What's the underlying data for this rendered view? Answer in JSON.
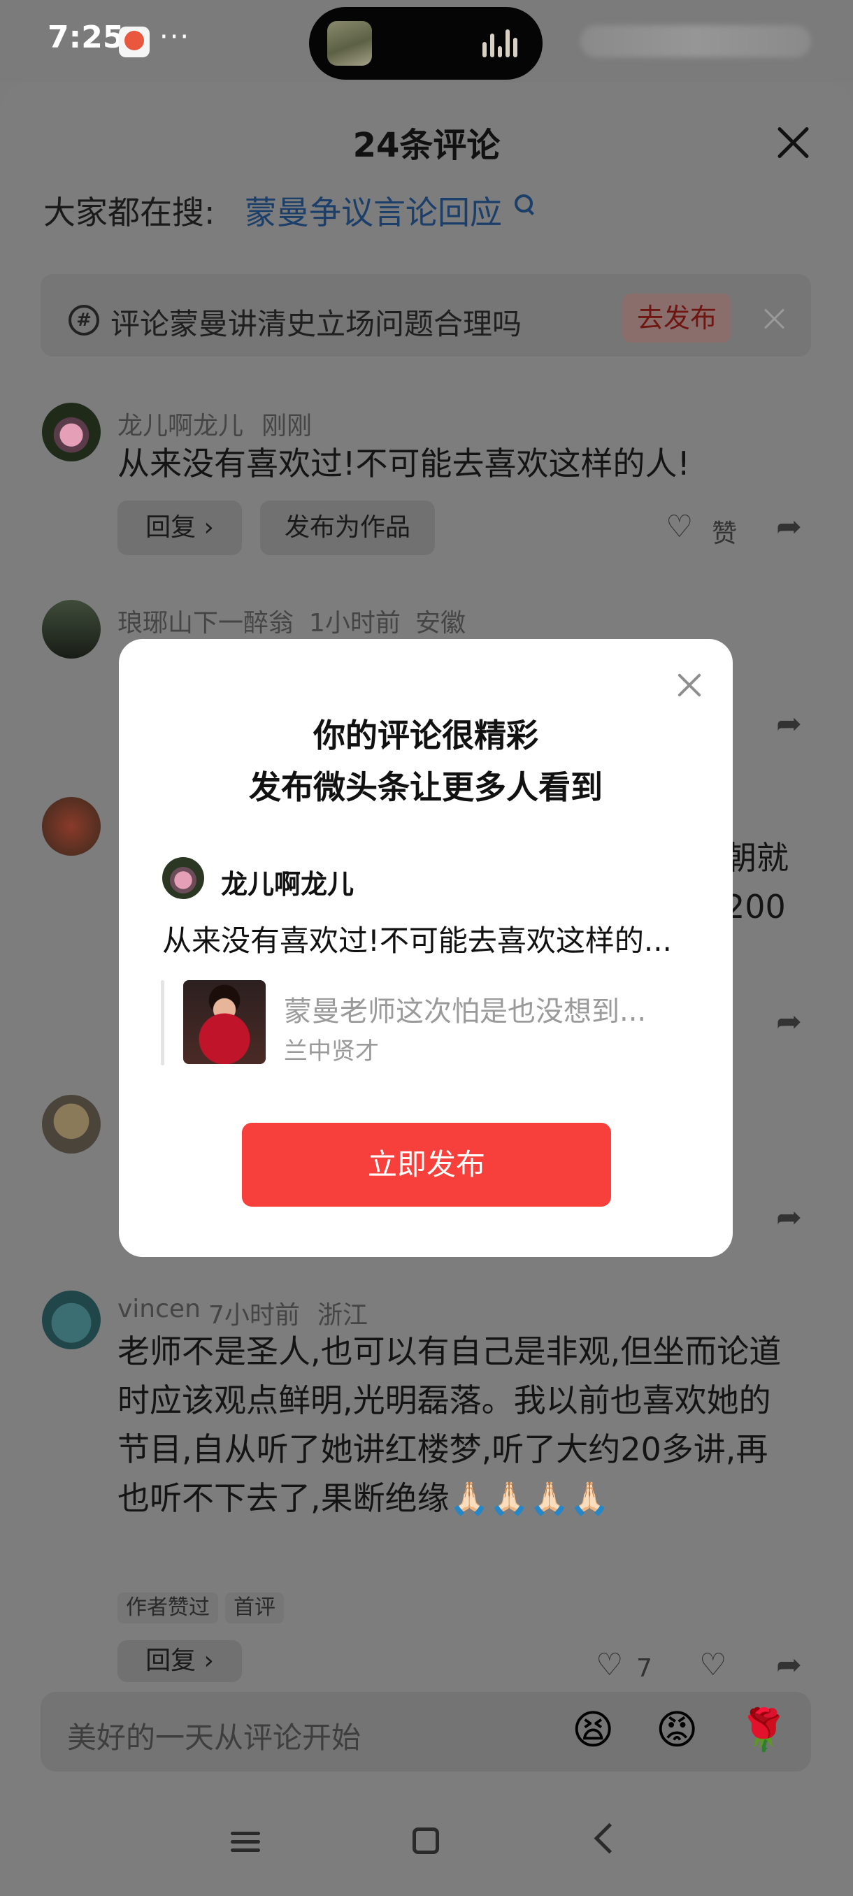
{
  "status_bar": {
    "time": "7:25",
    "dots": "···"
  },
  "sheet": {
    "title": "24条评论"
  },
  "search": {
    "label": "大家都在搜:",
    "link": "蒙曼争议言论回应"
  },
  "topic": {
    "text": "评论蒙曼讲清史立场问题合理吗",
    "button": "去发布"
  },
  "comments": [
    {
      "name": "龙儿啊龙儿",
      "time": "刚刚",
      "location": "",
      "text": "从来没有喜欢过!不可能去喜欢这样的人!",
      "reply": "回复",
      "publish": "发布为作品",
      "like": "赞"
    },
    {
      "name": "琅琊山下一醉翁",
      "time": "1小时前",
      "location": "安徽"
    },
    {
      "text_fragment_1": "朝就",
      "text_fragment_2": "200"
    },
    {
      "name": "vincen",
      "time": "7小时前",
      "location": "浙江",
      "text": "老师不是圣人,也可以有自己是非观,但坐而论道时应该观点鲜明,光明磊落。我以前也喜欢她的节目,自从听了她讲红楼梦,听了大约20多讲,再也听不下去了,果断绝缘🙏🏻🙏🏻🙏🏻🙏🏻",
      "tags": [
        "作者赞过",
        "首评"
      ],
      "reply": "回复",
      "like_count": "7"
    }
  ],
  "modal": {
    "title_line1": "你的评论很精彩",
    "title_line2": "发布微头条让更多人看到",
    "user_name": "龙儿啊龙儿",
    "comment_preview": "从来没有喜欢过!不可能去喜欢这样的...",
    "quote_text": "蒙曼老师这次怕是也没想到...",
    "quote_author": "兰中贤才",
    "button": "立即发布"
  },
  "input": {
    "placeholder": "美好的一天从评论开始",
    "emojis": [
      "😫",
      "😡",
      "🌹"
    ]
  }
}
